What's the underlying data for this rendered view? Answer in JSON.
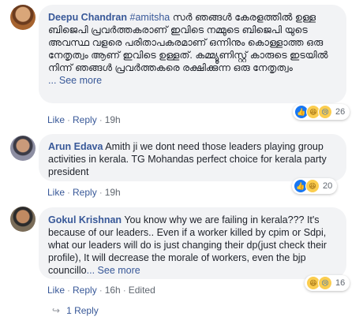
{
  "comments": [
    {
      "author": "Deepu Chandran",
      "tag": "#amitsha",
      "text": " സർ ഞങ്ങൾ കേരളത്തിൽ ഉള്ള ബിജെപി പ്രവർത്തകരാണ് ഇവിടെ നമ്മുടെ ബിജെപി യുടെ അവസ്ഥ വളരെ പരിതാപകരമാണ് ഒന്നിനും കൊള്ളാത്ത ഒരു നേതൃത്വം ആണ് ഇവിടെ ഉള്ളത്. കമ്മ്യൂണിസ്റ്റ് കാരുടെ ഇടയിൽ നിന്ന് ഞങ്ങൾ പ്രവർത്തകരെ രക്ഷിക്കുന്ന ഒരു നേതൃത്വം",
      "see_more": "... See more",
      "like": "Like",
      "reply": "Reply",
      "time": "19h",
      "reaction_count": "26",
      "reaction_icons": [
        "like-icon",
        "haha-icon",
        "sad-icon"
      ]
    },
    {
      "author": "Arun Edava",
      "text": " Amith ji we dont need those leaders playing group activities in kerala. TG Mohandas perfect choice for kerala party president",
      "like": "Like",
      "reply": "Reply",
      "time": "19h",
      "reaction_count": "20",
      "reaction_icons": [
        "like-icon",
        "haha-icon"
      ]
    },
    {
      "author": "Gokul Krishnan",
      "text": " You know why we are failing in kerala??? It's because of our leaders.. Even if a worker killed by cpim or Sdpi, what our leaders will do is just changing their dp(just check their profile), It will decrease the morale of workers, even the bjp councillo",
      "see_more": "... See more",
      "like": "Like",
      "reply": "Reply",
      "time": "16h",
      "edited": "Edited",
      "reaction_count": "16",
      "reaction_icons": [
        "haha-icon",
        "sad-icon"
      ]
    }
  ],
  "reply_link": "1 Reply",
  "colors": {
    "link": "#385898",
    "bubble": "#f2f3f5",
    "like": "#1877f2"
  }
}
